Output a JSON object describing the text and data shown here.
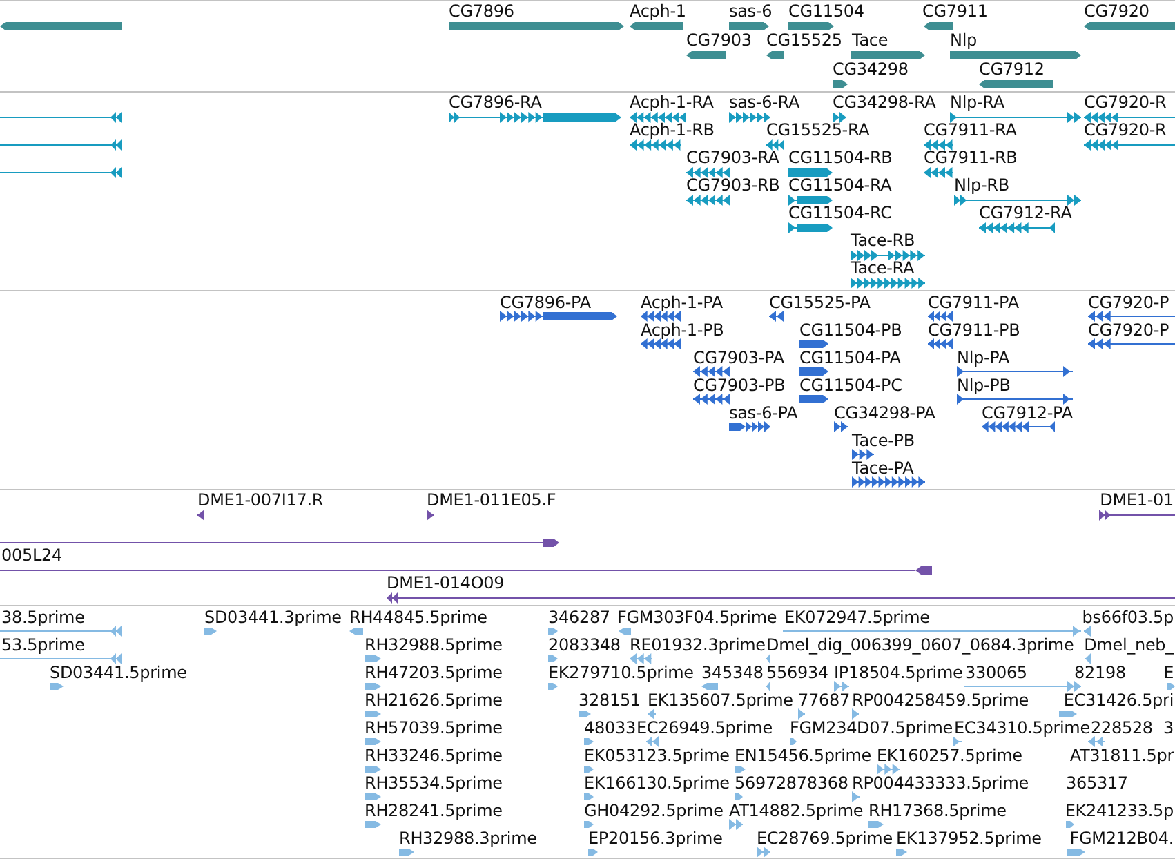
{
  "tracks": [
    {
      "kind": "gene",
      "features": [
        {
          "reverse": true
        },
        {
          "label": "CG7896",
          "reverse": false
        },
        {
          "label": "Acph-1",
          "reverse": true
        },
        {
          "label": "sas-6",
          "reverse": false
        },
        {
          "label": "CG11504",
          "reverse": false
        },
        {
          "label": "CG7911",
          "reverse": true
        },
        {
          "label": "CG7920",
          "reverse": true
        },
        {
          "label": "CG7903",
          "reverse": true
        },
        {
          "label": "CG15525",
          "reverse": true
        },
        {
          "label": "Tace",
          "reverse": false
        },
        {
          "label": "Nlp",
          "reverse": false
        },
        {
          "label": "CG34298",
          "reverse": false
        },
        {
          "label": "CG7912",
          "reverse": true
        }
      ]
    },
    {
      "kind": "transcript",
      "features": [
        {
          "reverse": true
        },
        {
          "label": "CG7896-RA",
          "reverse": false
        },
        {
          "label": "Acph-1-RA",
          "reverse": true
        },
        {
          "label": "sas-6-RA",
          "reverse": false
        },
        {
          "label": "CG34298-RA",
          "reverse": false
        },
        {
          "label": "Nlp-RA",
          "reverse": false
        },
        {
          "label": "CG7920-R",
          "reverse": true
        },
        {
          "reverse": true
        },
        {
          "label": "Acph-1-RB",
          "reverse": true
        },
        {
          "label": "CG15525-RA",
          "reverse": true
        },
        {
          "label": "CG7911-RA",
          "reverse": true
        },
        {
          "label": "CG7920-R",
          "reverse": true
        },
        {
          "reverse": true
        },
        {
          "label": "CG7903-RA",
          "reverse": true
        },
        {
          "label": "CG11504-RB",
          "reverse": false
        },
        {
          "label": "CG7911-RB",
          "reverse": true
        },
        {
          "label": "CG7903-RB",
          "reverse": true
        },
        {
          "label": "CG11504-RA",
          "reverse": false
        },
        {
          "label": "Nlp-RB",
          "reverse": false
        },
        {
          "label": "CG11504-RC",
          "reverse": false
        },
        {
          "label": "CG7912-RA",
          "reverse": true
        },
        {
          "label": "Tace-RB",
          "reverse": false
        },
        {
          "label": "Tace-RA",
          "reverse": false
        }
      ]
    },
    {
      "kind": "polypeptide",
      "features": [
        {
          "label": "CG7896-PA",
          "reverse": false
        },
        {
          "label": "Acph-1-PA",
          "reverse": true
        },
        {
          "label": "CG15525-PA",
          "reverse": true
        },
        {
          "label": "CG7911-PA",
          "reverse": true
        },
        {
          "label": "CG7920-P",
          "reverse": true
        },
        {
          "label": "Acph-1-PB",
          "reverse": true
        },
        {
          "label": "CG11504-PB",
          "reverse": false
        },
        {
          "label": "CG7911-PB",
          "reverse": true
        },
        {
          "label": "CG7920-P",
          "reverse": true
        },
        {
          "label": "CG7903-PA",
          "reverse": true
        },
        {
          "label": "CG11504-PA",
          "reverse": false
        },
        {
          "label": "Nlp-PA",
          "reverse": false
        },
        {
          "label": "CG7903-PB",
          "reverse": true
        },
        {
          "label": "CG11504-PC",
          "reverse": false
        },
        {
          "label": "Nlp-PB",
          "reverse": false
        },
        {
          "label": "sas-6-PA",
          "reverse": false
        },
        {
          "label": "CG34298-PA",
          "reverse": false
        },
        {
          "label": "CG7912-PA",
          "reverse": true
        },
        {
          "label": "Tace-PB",
          "reverse": false
        },
        {
          "label": "Tace-PA",
          "reverse": false
        }
      ]
    },
    {
      "kind": "clone",
      "features": [
        {
          "label": "DME1-007I17.R",
          "reverse": true
        },
        {
          "label": "DME1-011E05.F",
          "reverse": false
        },
        {
          "label": "DME1-01",
          "reverse": false
        },
        {
          "reverse": false
        },
        {
          "label": "005L24",
          "reverse": true
        },
        {
          "label": "DME1-014O09",
          "reverse": true
        }
      ]
    },
    {
      "kind": "est",
      "features": [
        {
          "label": "38.5prime",
          "reverse": true
        },
        {
          "label": "SD03441.3prime",
          "reverse": false
        },
        {
          "label": "RH44845.5prime",
          "reverse": true
        },
        {
          "label": "346287",
          "reverse": false
        },
        {
          "label": "FGM303F04.5prime",
          "reverse": true
        },
        {
          "label": "EK072947.5prime",
          "reverse": false
        },
        {
          "label": "bs66f03.5p",
          "reverse": true
        },
        {
          "label": "53.5prime",
          "reverse": true
        },
        {
          "label": "RH32988.5prime",
          "reverse": false
        },
        {
          "label": "2083348",
          "reverse": false
        },
        {
          "label": "RE01932.3prime",
          "reverse": true
        },
        {
          "label": "Dmel_dig_006399_0607_0684.3prime",
          "reverse": true
        },
        {
          "label": "Dmel_neb_",
          "reverse": true
        },
        {
          "label": "SD03441.5prime",
          "reverse": false
        },
        {
          "label": "RH47203.5prime",
          "reverse": false
        },
        {
          "label": "EK279710.5prime",
          "reverse": false
        },
        {
          "label": "345348",
          "reverse": true
        },
        {
          "label": "556934",
          "reverse": true
        },
        {
          "label": "IP18504.5prime",
          "reverse": false
        },
        {
          "label": "330065",
          "reverse": false
        },
        {
          "label": "82198"
        },
        {
          "label": "E",
          "reverse": false
        },
        {
          "label": "RH21626.5prime",
          "reverse": false
        },
        {
          "label": "328151",
          "reverse": false
        },
        {
          "label": "EK135607.5prime",
          "reverse": true
        },
        {
          "label": "77687",
          "reverse": false
        },
        {
          "label": "RP004258459.5prime",
          "reverse": false
        },
        {
          "label": "EC31426.5pri",
          "reverse": false
        },
        {
          "label": "RH57039.5prime",
          "reverse": false
        },
        {
          "label": "48033",
          "reverse": false
        },
        {
          "label": "EC26949.5prime",
          "reverse": true
        },
        {
          "label": "FGM234D07.5prime",
          "reverse": false
        },
        {
          "label": "EC34310.5prime",
          "reverse": false
        },
        {
          "label": "228528",
          "reverse": true
        },
        {
          "label": "3"
        },
        {
          "label": "RH33246.5prime",
          "reverse": false
        },
        {
          "label": "EK053123.5prime",
          "reverse": false
        },
        {
          "label": "EN15456.5prime",
          "reverse": false
        },
        {
          "label": "EK160257.5prime",
          "reverse": false
        },
        {
          "label": "AT31811.5pr"
        },
        {
          "label": "RH35534.5prime",
          "reverse": false
        },
        {
          "label": "EK166130.5prime",
          "reverse": false
        },
        {
          "label": "56972878368",
          "reverse": false
        },
        {
          "label": "RP004433333.5prime",
          "reverse": false
        },
        {
          "label": "365317"
        },
        {
          "label": "RH28241.5prime",
          "reverse": false
        },
        {
          "label": "GH04292.5prime",
          "reverse": false
        },
        {
          "label": "AT14882.5prime",
          "reverse": false
        },
        {
          "label": "RH17368.5prime",
          "reverse": false
        },
        {
          "label": "EK241233.5p",
          "reverse": false
        },
        {
          "label": "RH32988.3prime",
          "reverse": false
        },
        {
          "label": "EP20156.3prime",
          "reverse": false
        },
        {
          "label": "EC28769.5prime",
          "reverse": false
        },
        {
          "label": "EK137952.5prime",
          "reverse": false
        },
        {
          "label": "FGM212B04.",
          "reverse": false
        }
      ]
    }
  ]
}
